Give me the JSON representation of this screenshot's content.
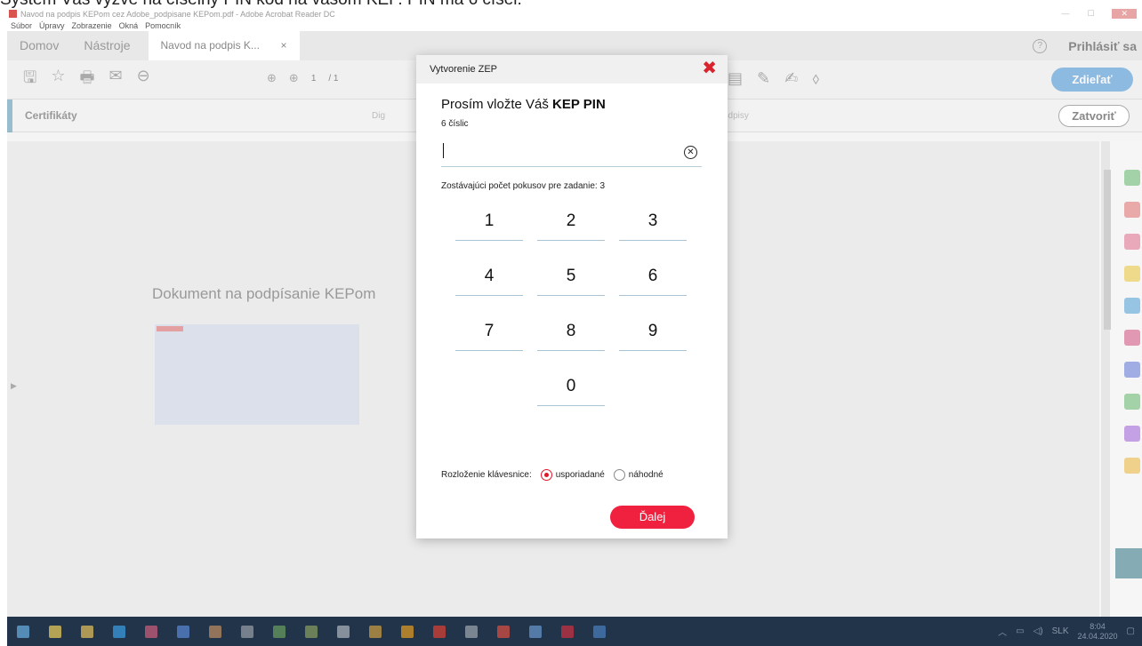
{
  "caption": "Systém Vás vyzve na číselný PIN kód na vašom KEP. PIN má 6 čísel.",
  "window": {
    "title": "Navod na podpis KEPom cez Adobe_podpisane KEPom.pdf - Adobe Acrobat Reader DC",
    "menu": [
      "Súbor",
      "Úpravy",
      "Zobrazenie",
      "Okná",
      "Pomocník"
    ]
  },
  "tabs": {
    "home": "Domov",
    "tools": "Nástroje",
    "doc": "Navod na podpis K...",
    "doc_close": "×",
    "help": "?",
    "signin": "Prihlásiť sa"
  },
  "toolbar": {
    "page_current": "1",
    "page_total": "/ 1",
    "share": "Zdieľať"
  },
  "certbar": {
    "label": "Certifikáty",
    "digital_id": "Dig",
    "signatures": "odpisy",
    "close": "Zatvoriť"
  },
  "document": {
    "heading": "Dokument na podpísanie KEPom"
  },
  "modal": {
    "title": "Vytvorenie ZEP",
    "prompt_prefix": "Prosím vložte Váš ",
    "prompt_bold": "KEP PIN",
    "digits_hint": "6 číslic",
    "pin_value": "",
    "remaining": "Zostávajúci počet pokusov pre zadanie: 3",
    "keys": [
      "1",
      "2",
      "3",
      "4",
      "5",
      "6",
      "7",
      "8",
      "9",
      "0"
    ],
    "layout_label": "Rozloženie klávesnice:",
    "layout_ordered": "usporiadané",
    "layout_random": "náhodné",
    "layout_selected": "usporiadané",
    "next": "Ďalej"
  },
  "taskbar": {
    "lang": "SLK",
    "time": "8:04",
    "date": "24.04.2020"
  },
  "colors": {
    "accent_red": "#f0213f",
    "close_red": "#d9232e",
    "share_blue": "#3d8fd6",
    "taskbar": "#22344a"
  }
}
